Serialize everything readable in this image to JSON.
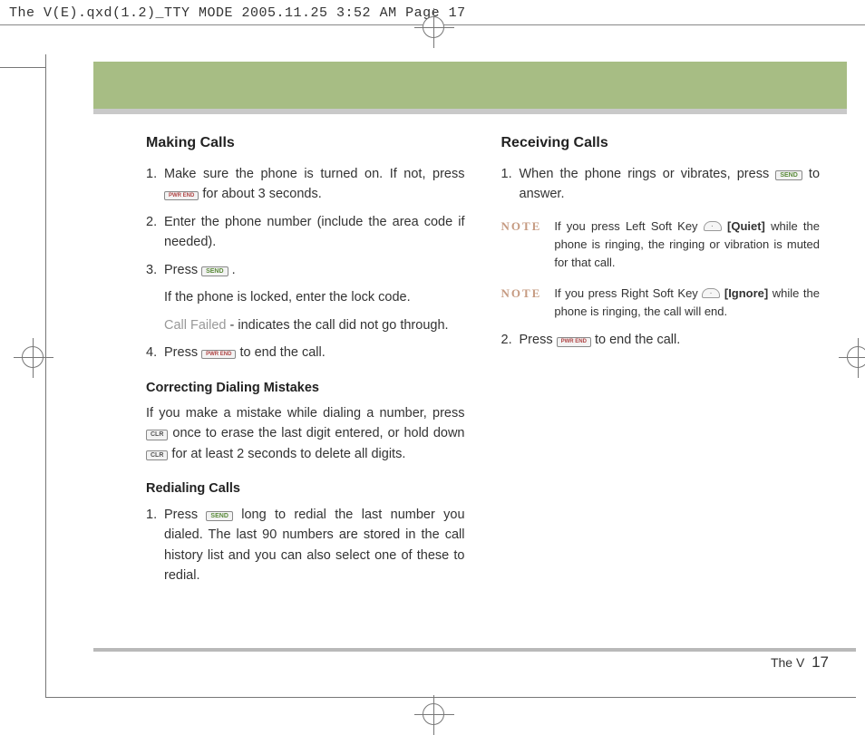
{
  "header": "The V(E).qxd(1.2)_TTY MODE  2005.11.25  3:52 AM  Page 17",
  "keys": {
    "send": "SEND",
    "end": "PWR\nEND",
    "clr": "CLR"
  },
  "left": {
    "h1": "Making Calls",
    "li1_num": "1.",
    "li1_a": "Make sure the phone is turned on. If not, press ",
    "li1_b": " for about 3 seconds.",
    "li2_num": "2.",
    "li2": "Enter the phone number (include the area code if needed).",
    "li3_num": "3.",
    "li3_a": "Press ",
    "li3_b": ".",
    "lock": "If the phone is locked, enter the lock code.",
    "failed_label": "Call Failed",
    "failed_rest": " - indicates the call did not go through.",
    "li4_num": "4.",
    "li4_a": "Press  ",
    "li4_b": "  to end the call.",
    "sub1": "Correcting Dialing Mistakes",
    "corr_a": "If you make a mistake while dialing a number, press ",
    "corr_b": " once to erase the last digit entered, or hold down ",
    "corr_c": " for at least 2 seconds to delete all digits.",
    "sub2": "Redialing Calls",
    "red_num": "1.",
    "red_a": "Press  ",
    "red_b": "  long to redial the last number you dialed. The last 90 numbers are stored in the call history list and you can also select one of these to redial."
  },
  "right": {
    "h1": "Receiving Calls",
    "li1_num": "1.",
    "li1_a": "When the phone rings or vibrates, press  ",
    "li1_b": "  to answer.",
    "note_label": "NOTE",
    "note1_a": "If you press Left Soft Key ",
    "note1_quiet": " [Quiet] ",
    "note1_b": "while the phone is ringing, the ringing or vibration is muted for that call.",
    "note2_a": "If you press Right Soft Key ",
    "note2_ignore": " [Ignore] ",
    "note2_b": "while the phone is ringing,  the call  will end.",
    "li2_num": "2.",
    "li2_a": "Press  ",
    "li2_b": "  to end the call."
  },
  "footer": {
    "label": "The V",
    "page": "17"
  }
}
